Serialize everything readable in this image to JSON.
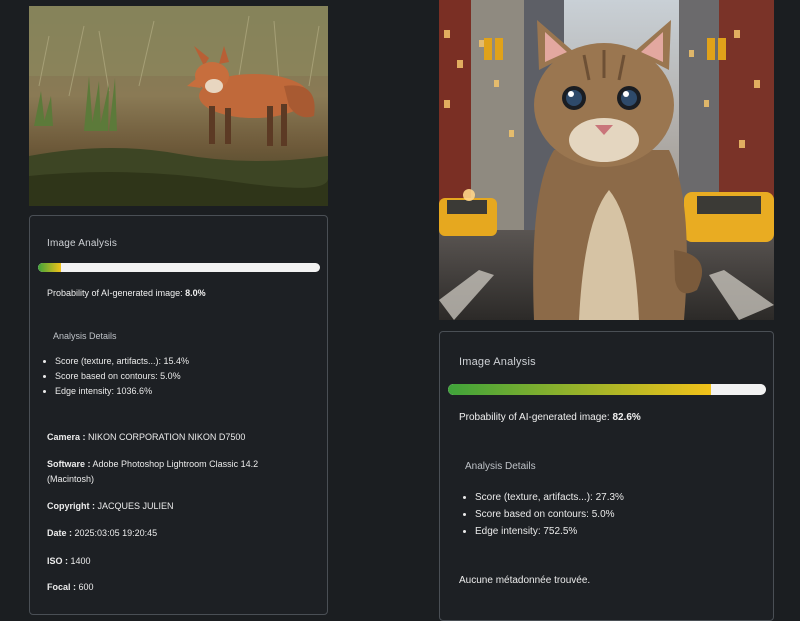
{
  "left": {
    "photo_subject": "fox",
    "card_title": "Image Analysis",
    "probability_label": "Probability of AI-generated image:",
    "probability_value": "8.0%",
    "probability_fraction": 0.08,
    "details_title": "Analysis Details",
    "details": [
      "Score (texture, artifacts...): 15.4%",
      "Score based on contours: 5.0%",
      "Edge intensity: 1036.6%"
    ],
    "metadata": [
      {
        "label": "Camera :",
        "value": "NIKON CORPORATION NIKON D7500"
      },
      {
        "label": "Software :",
        "value": "Adobe Photoshop Lightroom Classic 14.2 (Macintosh)"
      },
      {
        "label": "Copyright :",
        "value": "JACQUES JULIEN"
      },
      {
        "label": "Date :",
        "value": "2025:03:05 19:20:45"
      },
      {
        "label": "ISO :",
        "value": "1400"
      },
      {
        "label": "Focal :",
        "value": "600"
      }
    ]
  },
  "right": {
    "photo_subject": "cat",
    "card_title": "Image Analysis",
    "probability_label": "Probability of AI-generated image:",
    "probability_value": "82.6%",
    "probability_fraction": 0.826,
    "details_title": "Analysis Details",
    "details": [
      "Score (texture, artifacts...): 27.3%",
      "Score based on contours: 5.0%",
      "Edge intensity: 752.5%"
    ],
    "no_metadata": "Aucune métadonnée trouvée."
  },
  "colors": {
    "page_bg": "#1b1e21",
    "card_border": "#4a4f55",
    "bar_track": "#f2f2f2",
    "bar_green": "#3fa33a",
    "bar_yellow": "#f2c21a"
  }
}
